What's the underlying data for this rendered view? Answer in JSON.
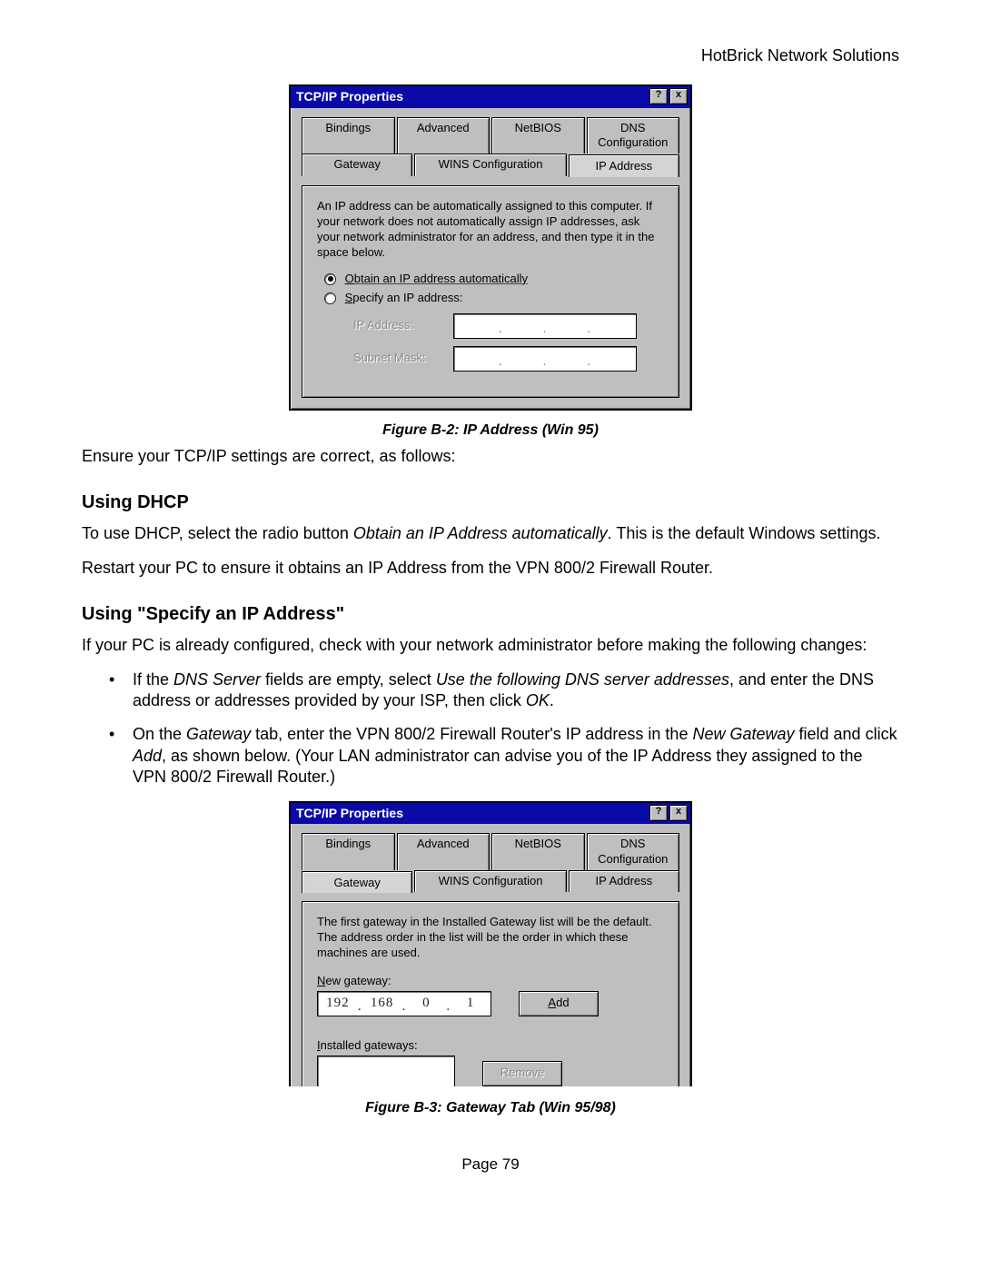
{
  "header": {
    "right": "HotBrick Network Solutions"
  },
  "dialog1": {
    "title": "TCP/IP Properties",
    "helpBtn": "?",
    "closeBtn": "x",
    "tabsRow1": [
      "Bindings",
      "Advanced",
      "NetBIOS",
      "DNS Configuration"
    ],
    "tabsRow2": [
      "Gateway",
      "WINS Configuration",
      "IP Address"
    ],
    "activeTab": "IP Address",
    "helpText": "An IP address can be automatically assigned to this computer. If your network does not automatically assign IP addresses, ask your network administrator for an address, and then type it in the space below.",
    "radio1": "Obtain an IP address automatically",
    "radio2": "Specify an IP address:",
    "fieldLabel1": "IP Address:",
    "fieldLabel2": "Subnet Mask:"
  },
  "caption1": "Figure B-2: IP Address (Win 95)",
  "intro": "Ensure your TCP/IP settings are correct, as follows:",
  "sectionA": {
    "heading": "Using DHCP",
    "p1a": "To use DHCP, select the radio button ",
    "p1b": "Obtain an IP Address automatically",
    "p1c": ". This is the default Windows settings.",
    "p2": "Restart your PC to ensure it obtains an IP Address from the VPN 800/2 Firewall Router."
  },
  "sectionB": {
    "heading": "Using \"Specify an IP Address\"",
    "p1": "If your PC is already configured, check with your network administrator before making the following changes:",
    "li1a": "If the ",
    "li1b": "DNS Server",
    "li1c": " fields are empty, select ",
    "li1d": "Use the following DNS server addresses",
    "li1e": ", and enter the DNS address or addresses provided by your ISP, then click ",
    "li1f": "OK",
    "li1g": ".",
    "li2a": "On the ",
    "li2b": "Gateway",
    "li2c": " tab, enter the VPN 800/2 Firewall Router's IP address in the ",
    "li2d": "New Gateway",
    "li2e": " field and click ",
    "li2f": "Add",
    "li2g": ", as shown below. (Your LAN administrator can advise you of the IP Address they assigned to the VPN 800/2 Firewall Router.)"
  },
  "dialog2": {
    "title": "TCP/IP Properties",
    "helpBtn": "?",
    "closeBtn": "x",
    "tabsRow1": [
      "Bindings",
      "Advanced",
      "NetBIOS",
      "DNS Configuration"
    ],
    "tabsRow2": [
      "Gateway",
      "WINS Configuration",
      "IP Address"
    ],
    "activeTab": "Gateway",
    "helpText": "The first gateway in the Installed Gateway list will be the default. The address order in the list will be the order in which these machines are used.",
    "newGatewayLabel": "New gateway:",
    "ip": [
      "192",
      "168",
      "0",
      "1"
    ],
    "addBtn": "Add",
    "installedLabel": "Installed gateways:",
    "removeBtn": "Remove"
  },
  "caption2": "Figure B-3: Gateway Tab (Win 95/98)",
  "pageNum": "Page 79"
}
